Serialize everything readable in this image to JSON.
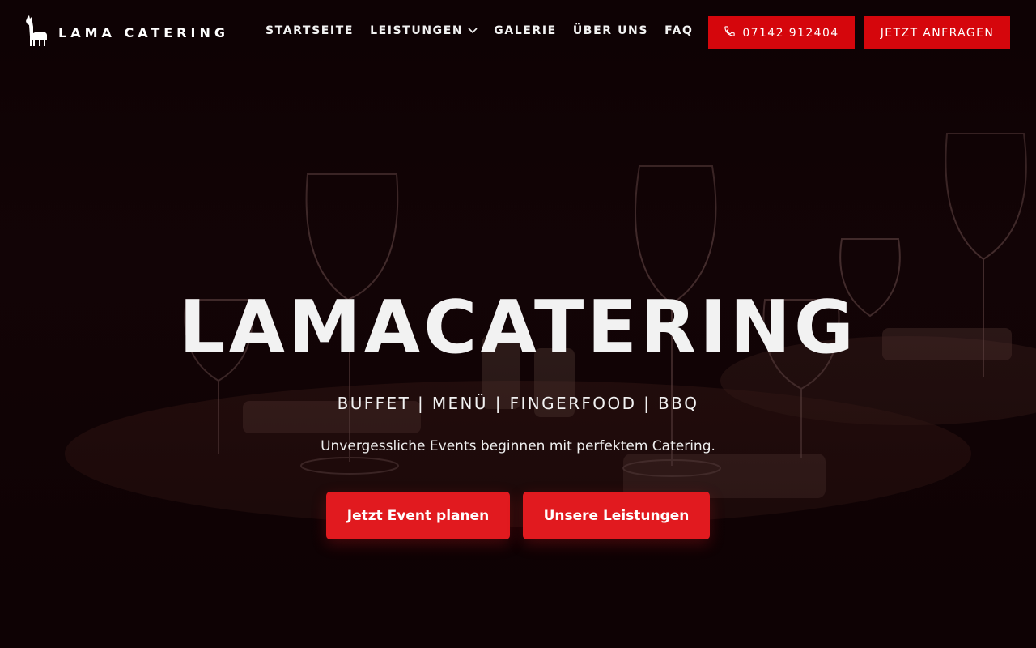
{
  "nav": {
    "logo_text": "LAMA CATERING",
    "menu": [
      {
        "label": "STARTSEITE"
      },
      {
        "label": "LEISTUNGEN"
      },
      {
        "label": "GALERIE"
      },
      {
        "label": "ÜBER UNS"
      },
      {
        "label": "FAQ"
      }
    ],
    "phone_label": "07142 912404",
    "request_label": "JETZT ANFRAGEN"
  },
  "hero": {
    "title": "LAMACATERING",
    "tagline": "BUFFET | MENÜ | FINGERFOOD | BBQ",
    "subtitle": "Unvergessliche Events beginnen mit perfektem Catering.",
    "cta_primary": "Jetzt Event planen",
    "cta_secondary": "Unsere Leistungen"
  },
  "icons": {
    "logo": "llama-icon",
    "dropdown": "chevron-down-icon",
    "phone": "phone-icon"
  },
  "colors": {
    "accent": "#d5060c",
    "cta": "#e11a1f",
    "text": "#f2f2f2",
    "background": "#1e0709"
  }
}
